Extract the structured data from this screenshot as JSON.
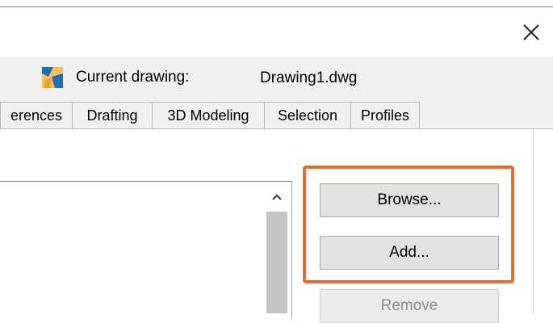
{
  "header": {
    "current_label": "Current drawing:",
    "drawing_name": "Drawing1.dwg"
  },
  "tabs": [
    {
      "label": "erences"
    },
    {
      "label": "Drafting"
    },
    {
      "label": "3D Modeling"
    },
    {
      "label": "Selection"
    },
    {
      "label": "Profiles"
    }
  ],
  "buttons": {
    "browse": "Browse...",
    "add": "Add...",
    "remove": "Remove"
  },
  "icons": {
    "close": "close-icon",
    "drawing": "drawing-icon",
    "scroll_up": "chevron-up-icon"
  },
  "colors": {
    "highlight": "#e06e2c"
  }
}
